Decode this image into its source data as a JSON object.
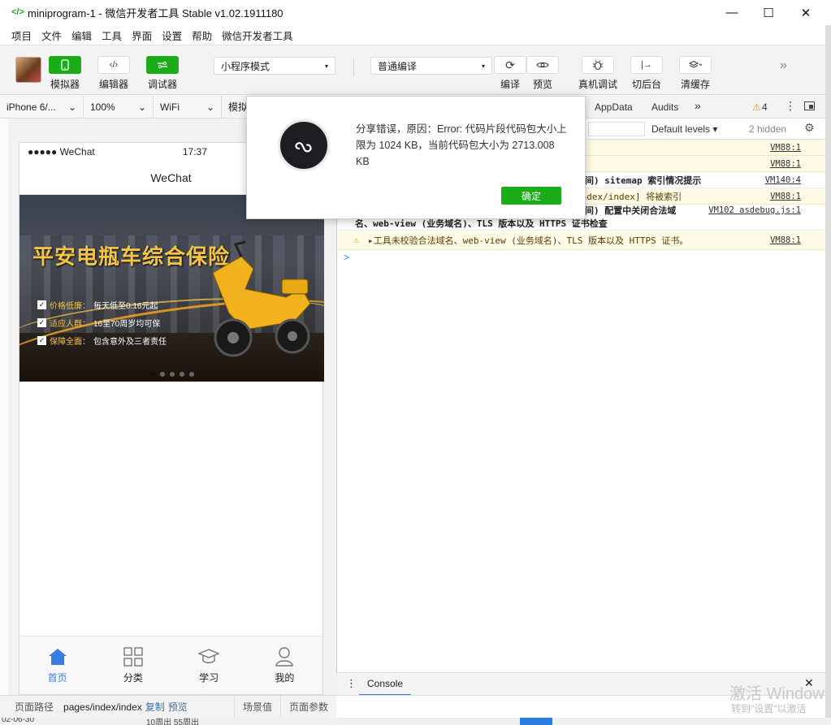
{
  "window": {
    "title": "miniprogram-1 - 微信开发者工具 Stable v1.02.1911180",
    "icon": "</>",
    "controls": [
      "—",
      "☐",
      "✕"
    ]
  },
  "menu": [
    "项目",
    "文件",
    "编辑",
    "工具",
    "界面",
    "设置",
    "帮助",
    "微信开发者工具"
  ],
  "toolbar": {
    "simulator": "模拟器",
    "editor": "编辑器",
    "debugger": "调试器",
    "mode_select": "小程序模式",
    "compile_select": "普通编译",
    "compile": "编译",
    "preview": "预览",
    "remote_debug": "真机调试",
    "background": "切后台",
    "clear_cache": "清缓存",
    "more": "»"
  },
  "simbar": {
    "device": "iPhone 6/...",
    "zoom": "100%",
    "network": "WiFi",
    "sim_label": "模拟"
  },
  "phone": {
    "carrier": "●●●●● WeChat",
    "time": "17:37",
    "nav_title": "WeChat",
    "banner": {
      "headline": "平安电瓶车综合保险",
      "bullets": [
        {
          "key": "价格低廉：",
          "text": "每天低至0.16元起"
        },
        {
          "key": "适应人群：",
          "text": "16至70周岁均可保"
        },
        {
          "key": "保障全面：",
          "text": "包含意外及三者责任"
        }
      ]
    },
    "tabs": [
      {
        "label": "首页",
        "icon": "home-icon",
        "active": true
      },
      {
        "label": "分类",
        "icon": "grid-icon",
        "active": false
      },
      {
        "label": "学习",
        "icon": "graduation-cap-icon",
        "active": false
      },
      {
        "label": "我的",
        "icon": "user-icon",
        "active": false
      }
    ]
  },
  "bottombar": {
    "path_label": "页面路径",
    "path": "pages/index/index",
    "copy": "复制",
    "preview": "预览",
    "scene": "场景值",
    "params": "页面参数"
  },
  "statusline": {
    "date": "02-06-30",
    "info": "10周出 55周出"
  },
  "devtools": {
    "tabs": [
      "AppData",
      "Audits",
      "»"
    ],
    "warn_count": "4",
    "filter_levels": "Default levels ▾",
    "hidden": "2 hidden",
    "rows": [
      {
        "msg": "",
        "src": "VM88:1",
        "type": "warn"
      },
      {
        "msg": "",
        "src": "VM88:1",
        "type": "warn"
      },
      {
        "msg": "时间) sitemap 索引情况提示",
        "src": "VM140:4",
        "type": "bold"
      },
      {
        "msg": "index/index] 将被索引",
        "src": "VM88:1",
        "type": "warn"
      },
      {
        "msg": "时间) 配置中关闭合法域",
        "src": "VM102 asdebug.js:1",
        "type": "bold"
      },
      {
        "msg": "名、web-view (业务域名)、TLS 版本以及 HTTPS 证书检查",
        "src": "",
        "type": "bold"
      },
      {
        "msg": "▸工具未校验合法域名、web-view (业务域名)、TLS 版本以及 HTTPS 证书。",
        "src": "VM88:1",
        "type": "warn-icon"
      }
    ],
    "prompt": ">",
    "drawer_tab": "Console",
    "drawer_close": "✕",
    "drawer_menu": "⋮"
  },
  "dialog": {
    "message": "分享错误，原因：Error: 代码片段代码包大小上限为 1024 KB，当前代码包大小为 2713.008 KB",
    "ok": "确定"
  },
  "watermark": {
    "line1": "激活 Window",
    "line2": "转到\"设置\"以激活"
  },
  "colors": {
    "brand_green": "#1aad19",
    "active_blue": "#3a7de0",
    "warn_bg": "#fffbe6"
  }
}
